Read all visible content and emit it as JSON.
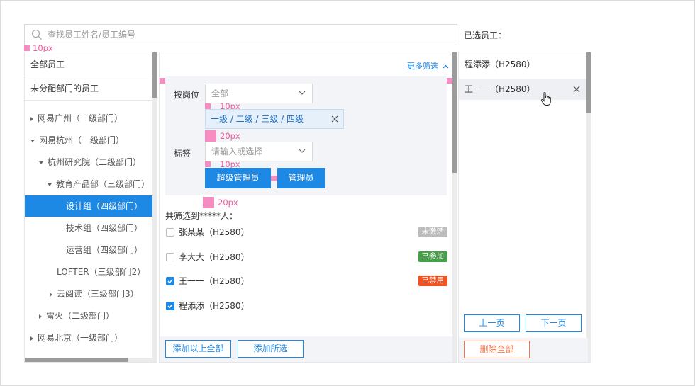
{
  "search": {
    "placeholder": "查找员工姓名/员工编号"
  },
  "selected_title": "已选员工：",
  "annotations": {
    "a1": "10px",
    "a2": "10px",
    "a3": "20px",
    "a4": "10px",
    "a5": "20px"
  },
  "left": {
    "all_staff": "全部员工",
    "unassigned": "未分配部门的员工",
    "tree": [
      {
        "label": "网易广州（一级部门）",
        "caret": "right"
      },
      {
        "label": "网易杭州（一级部门）",
        "caret": "down"
      },
      {
        "label": "杭州研究院（二级部门）",
        "caret": "down"
      },
      {
        "label": "教育产品部（三级部门）",
        "caret": "down"
      },
      {
        "label": "设计组（四级部门）",
        "caret": "",
        "active": true
      },
      {
        "label": "技术组（四级部门）",
        "caret": ""
      },
      {
        "label": "运营组（四级部门）",
        "caret": ""
      },
      {
        "label": "LOFTER（三级部门2）",
        "caret": ""
      },
      {
        "label": "云阅读（三级部门3）",
        "caret": "right"
      },
      {
        "label": "雷火（二级部门）",
        "caret": "right"
      },
      {
        "label": "网易北京（一级部门）",
        "caret": "right"
      }
    ]
  },
  "middle": {
    "more_filter": "更多筛选",
    "filter": {
      "position_label": "按岗位",
      "position_value": "全部",
      "chip_text": "一级 / 二级  / 三级  / 四级",
      "tag_label": "标签",
      "tag_placeholder": "请输入或选择",
      "tag_buttons": [
        "超级管理员",
        "管理员"
      ]
    },
    "count_text": "共筛选到*****人：",
    "employees": [
      {
        "name": "张某某（H2580）",
        "checked": false,
        "badge": "未激活",
        "badge_color": "#bdbdbd"
      },
      {
        "name": "李大大（H2580）",
        "checked": false,
        "badge": "已参加",
        "badge_color": "#43a047"
      },
      {
        "name": "王一一（H2580）",
        "checked": true,
        "badge": "已禁用",
        "badge_color": "#f4511e"
      },
      {
        "name": "程添添（H2580）",
        "checked": true,
        "badge": "",
        "badge_color": ""
      }
    ],
    "add_all": "添加以上全部",
    "add_selected": "添加所选"
  },
  "right": {
    "selected": [
      {
        "name": "程添添（H2580）"
      },
      {
        "name": "王一一（H2580）"
      }
    ],
    "prev_page": "上一页",
    "next_page": "下一页",
    "delete_all": "删除全部"
  },
  "colors": {
    "accent": "#1e88e5",
    "danger": "#f5734a",
    "annotation": "#f0589c"
  }
}
